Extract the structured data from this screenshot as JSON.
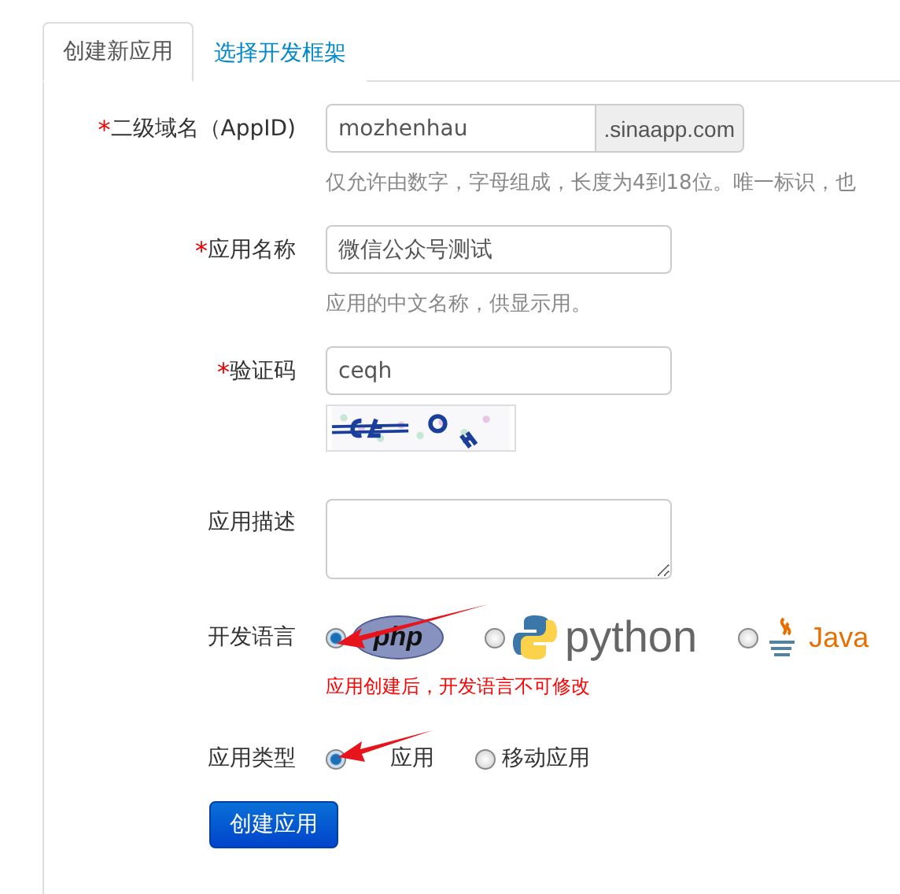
{
  "tabs": [
    {
      "label": "创建新应用",
      "selected": true
    },
    {
      "label": "选择开发框架",
      "selected": false
    }
  ],
  "fields": [
    {
      "kind": "addon",
      "label": "二级域名（AppID)",
      "mark": "*",
      "value": "mozhenhau",
      "addon": ".sinaapp.com",
      "help": "仅允许由数字，字母组成，长度为4到18位。唯一标识，也"
    },
    {
      "kind": "text",
      "label": "应用名称",
      "mark": "*",
      "value": "微信公众号测试",
      "help": "应用的中文名称，供显示用。"
    },
    {
      "kind": "captcha",
      "label": "验证码",
      "mark": "*",
      "value": "ceqh"
    },
    {
      "kind": "textarea",
      "label": "应用描述"
    },
    {
      "kind": "radios",
      "label": "开发语言",
      "options": [
        {
          "kind": "php",
          "label": "php",
          "selected": true
        },
        {
          "kind": "python",
          "label": "python",
          "selected": false
        },
        {
          "kind": "java",
          "label": "Java",
          "selected": false
        }
      ],
      "warning": "应用创建后，开发语言不可修改"
    },
    {
      "kind": "radios",
      "label": "应用类型",
      "options": [
        {
          "kind": "text",
          "label": "应用",
          "selected": true
        },
        {
          "kind": "text",
          "label": "移动应用",
          "selected": false
        }
      ]
    }
  ],
  "submit": "创建应用"
}
